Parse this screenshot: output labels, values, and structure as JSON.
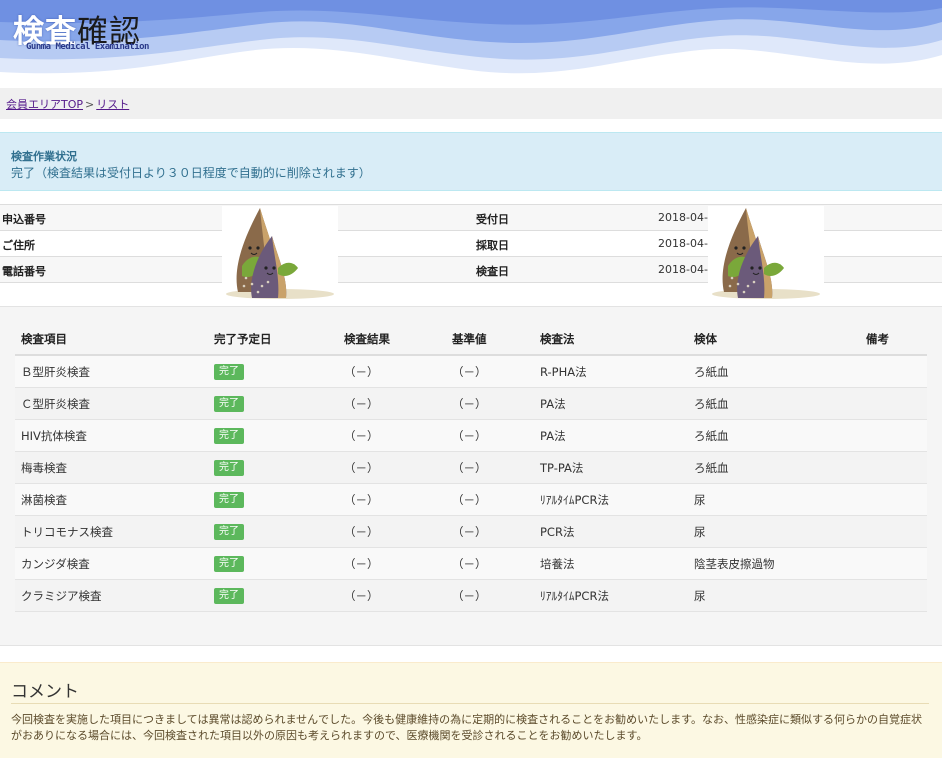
{
  "header": {
    "title_part1": "検査",
    "title_part2": "確認",
    "subtitle": "Gunma Medical Examination"
  },
  "breadcrumb": {
    "items": [
      "会員エリアTOP",
      "リスト"
    ],
    "separator": ">"
  },
  "status": {
    "title": "検査作業状況",
    "text": "完了（検査結果は受付日より３０日程度で自動的に削除されます）"
  },
  "info": {
    "rows": [
      {
        "label_left": "申込番号",
        "label_right": "受付日",
        "value_right": "2018-04-1"
      },
      {
        "label_left": "ご住所",
        "label_right": "採取日",
        "value_right": "2018-04-1"
      },
      {
        "label_left": "電話番号",
        "label_right": "検査日",
        "value_right": "2018-04-1"
      }
    ]
  },
  "results": {
    "headers": [
      "検査項目",
      "完了予定日",
      "検査結果",
      "基準値",
      "検査法",
      "検体",
      "備考"
    ],
    "rows": [
      {
        "item": "Ｂ型肝炎検査",
        "status": "完了",
        "result": "（－）",
        "ref": "（－）",
        "method": "R-PHA法",
        "specimen": "ろ紙血",
        "note": ""
      },
      {
        "item": "Ｃ型肝炎検査",
        "status": "完了",
        "result": "（－）",
        "ref": "（－）",
        "method": "PA法",
        "specimen": "ろ紙血",
        "note": ""
      },
      {
        "item": "HIV抗体検査",
        "status": "完了",
        "result": "（－）",
        "ref": "（－）",
        "method": "PA法",
        "specimen": "ろ紙血",
        "note": ""
      },
      {
        "item": "梅毒検査",
        "status": "完了",
        "result": "（－）",
        "ref": "（－）",
        "method": "TP-PA法",
        "specimen": "ろ紙血",
        "note": ""
      },
      {
        "item": "淋菌検査",
        "status": "完了",
        "result": "（－）",
        "ref": "（－）",
        "method": "ﾘｱﾙﾀｲﾑPCR法",
        "specimen": "尿",
        "note": ""
      },
      {
        "item": "トリコモナス検査",
        "status": "完了",
        "result": "（－）",
        "ref": "（－）",
        "method": "PCR法",
        "specimen": "尿",
        "note": ""
      },
      {
        "item": "カンジダ検査",
        "status": "完了",
        "result": "（－）",
        "ref": "（－）",
        "method": "培養法",
        "specimen": "陰茎表皮擦過物",
        "note": ""
      },
      {
        "item": "クラミジア検査",
        "status": "完了",
        "result": "（－）",
        "ref": "（－）",
        "method": "ﾘｱﾙﾀｲﾑPCR法",
        "specimen": "尿",
        "note": ""
      }
    ]
  },
  "comment": {
    "title": "コメント",
    "text": "今回検査を実施した項目につきましては異常は認められませんでした。今後も健康維持の為に定期的に検査されることをお勧めいたします。なお、性感染症に類似する何らかの自覚症状がおありになる場合には、今回検査された項目以外の原因も考えられますので、医療機関を受診されることをお勧めいたします。"
  },
  "colors": {
    "wave_light": "#d6e2f8",
    "wave_dark": "#7d9ce6",
    "status_bg": "#d9edf7",
    "status_text": "#31708f",
    "badge_green": "#5cb85c",
    "comment_bg": "#fcf8e3"
  },
  "icons": [
    "bamboo-shoot-mascot-icon"
  ]
}
